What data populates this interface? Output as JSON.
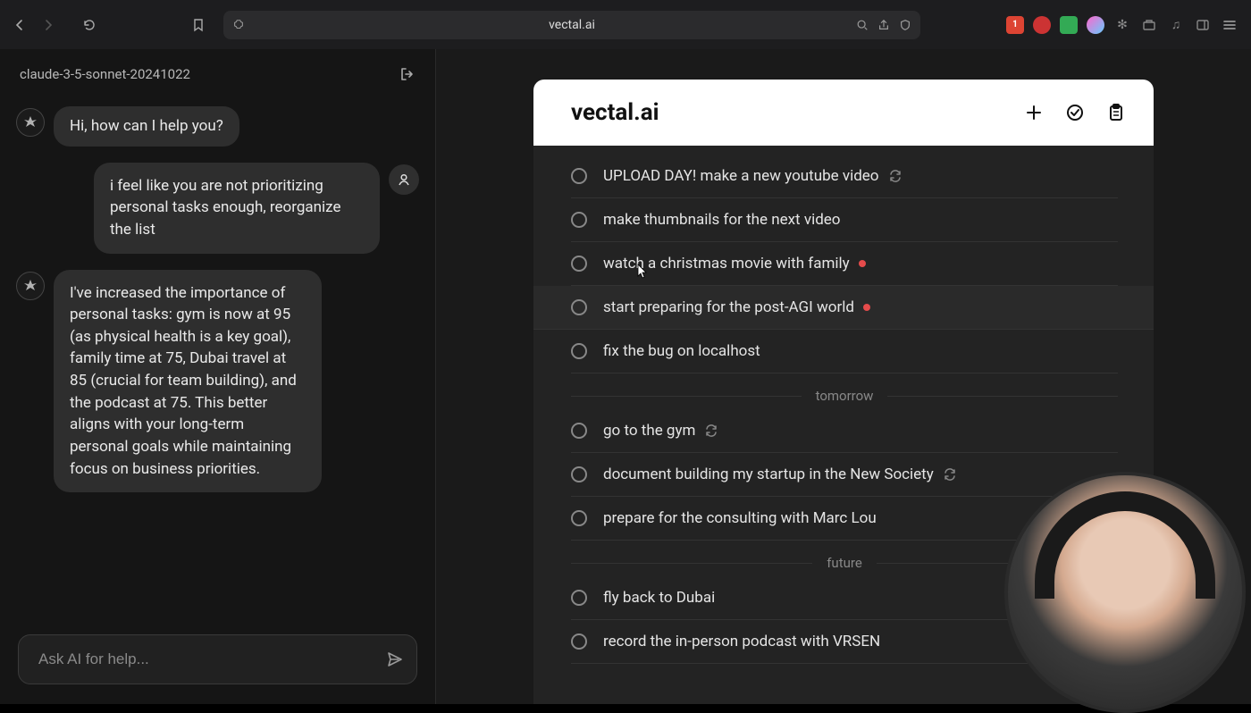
{
  "browser": {
    "url": "vectal.ai"
  },
  "sidebar": {
    "model_label": "claude-3-5-sonnet-20241022",
    "messages": {
      "greeting": "Hi, how can I help you?",
      "user1": "i feel like you are not prioritizing personal tasks enough, reorganize the list",
      "assistant1": "I've increased the importance of personal tasks: gym is now at 95 (as physical health is a key goal), family time at 75, Dubai travel at 85 (crucial for team building), and the podcast at 75. This better aligns with your long-term personal goals while maintaining focus on business priorities."
    },
    "composer_placeholder": "Ask AI for help..."
  },
  "app": {
    "title": "vectal.ai",
    "sections": [
      {
        "id": "today",
        "label": "",
        "tasks": [
          {
            "text": "UPLOAD DAY! make a new youtube video",
            "recur": true,
            "red": false
          },
          {
            "text": "make thumbnails for the next video",
            "recur": false,
            "red": false
          },
          {
            "text": "watch a christmas movie with family",
            "recur": false,
            "red": true
          },
          {
            "text": "start preparing for the post-AGI world",
            "recur": false,
            "red": true,
            "hovered": true
          },
          {
            "text": "fix the bug on localhost",
            "recur": false,
            "red": false
          }
        ]
      },
      {
        "id": "tomorrow",
        "label": "tomorrow",
        "tasks": [
          {
            "text": "go to the gym",
            "recur": true,
            "red": false
          },
          {
            "text": "document building my startup in the New Society",
            "recur": true,
            "red": false
          },
          {
            "text": "prepare for the consulting with Marc Lou",
            "recur": false,
            "red": false
          }
        ]
      },
      {
        "id": "future",
        "label": "future",
        "tasks": [
          {
            "text": "fly back to Dubai",
            "recur": false,
            "red": false
          },
          {
            "text": "record the in-person podcast with VRSEN",
            "recur": false,
            "red": false
          }
        ]
      }
    ]
  }
}
